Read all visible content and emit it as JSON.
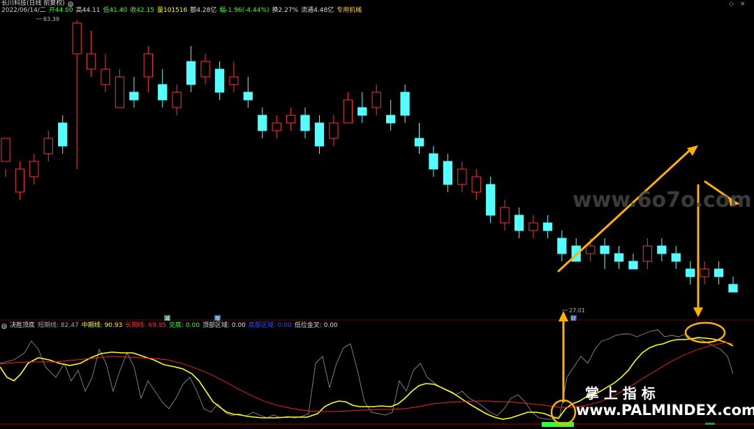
{
  "header": {
    "title": "长川科技(日线 前复权)",
    "date": "2022/06/14/二",
    "open": "开44.00",
    "high": "高44.11",
    "low": "低41.40",
    "close": "收42.15",
    "volume": "量101516",
    "amount": "额4.28亿",
    "change": "幅-1.96(-4.44%)",
    "turnover": "换2.27%",
    "float": "流通4.48亿",
    "sector": "专用机械"
  },
  "price_chart": {
    "max_label": "63.39",
    "min_label": "27.01",
    "marker_labels": [
      "减",
      "增",
      "财"
    ]
  },
  "indicator": {
    "name": "决胜顶底",
    "short": "短期线: 82.47",
    "mid": "中期线: 90.93",
    "long": "长期线: 69.95",
    "bottom": "见底: 0.00",
    "top_zone": "顶部区域: 0.00",
    "bottom_zone": "底部区域: 0.00",
    "golden": "低位金叉: 0.00"
  },
  "watermarks": {
    "top": "www.6o7o.com",
    "cn": "掌 上 指 标",
    "bottom": "www.PALMINDEX.com"
  },
  "colors": {
    "up": "#ff3333",
    "down": "#54ffff",
    "mid_line": "#ffff00",
    "long_line": "#ff2020",
    "short_line": "#9a9a9a",
    "arrow": "#ffb000"
  },
  "chart_data": {
    "type": "candlestick",
    "ylim": [
      26,
      64
    ],
    "candles": [
      [
        45,
        48,
        44,
        43
      ],
      [
        41,
        44,
        45,
        40
      ],
      [
        43,
        45,
        46,
        42
      ],
      [
        46,
        48,
        49,
        45
      ],
      [
        50,
        47,
        51,
        46
      ],
      [
        59,
        63,
        63.4,
        44
      ],
      [
        57,
        59,
        62,
        56
      ],
      [
        55,
        57,
        59,
        54
      ],
      [
        52,
        56,
        57,
        52
      ],
      [
        54,
        53,
        56,
        52
      ],
      [
        56,
        59,
        60,
        54
      ],
      [
        55,
        53,
        57,
        52
      ],
      [
        52,
        54,
        55,
        51
      ],
      [
        58,
        55,
        60,
        54
      ],
      [
        56,
        58,
        59,
        55
      ],
      [
        57,
        54,
        58,
        53
      ],
      [
        55,
        56,
        58,
        54
      ],
      [
        54,
        53,
        56,
        52
      ],
      [
        51,
        49,
        52,
        48
      ],
      [
        49,
        50,
        51,
        48
      ],
      [
        50,
        51,
        52,
        49
      ],
      [
        51,
        49,
        52,
        48
      ],
      [
        50,
        47,
        51,
        46
      ],
      [
        48,
        50,
        51,
        47
      ],
      [
        50,
        53,
        54,
        50
      ],
      [
        52,
        51,
        54,
        50
      ],
      [
        52,
        54,
        55,
        51
      ],
      [
        51,
        50,
        53,
        49
      ],
      [
        54,
        51,
        55,
        50
      ],
      [
        48,
        47,
        50,
        46
      ],
      [
        46,
        44,
        47,
        43
      ],
      [
        45,
        42,
        46,
        41
      ],
      [
        42,
        44,
        45,
        41
      ],
      [
        41,
        43,
        44,
        40
      ],
      [
        42,
        38,
        43,
        37
      ],
      [
        37,
        39,
        40,
        36
      ],
      [
        38,
        36,
        39,
        35
      ],
      [
        36,
        37,
        38,
        35
      ],
      [
        37,
        36,
        38,
        35
      ],
      [
        35,
        33,
        36,
        32
      ],
      [
        34,
        32,
        35,
        32
      ],
      [
        33,
        34,
        35,
        32
      ],
      [
        34,
        33,
        35,
        31
      ],
      [
        33,
        32,
        34,
        31
      ],
      [
        32,
        31,
        33,
        31
      ],
      [
        32,
        34,
        35,
        31
      ],
      [
        34,
        33,
        35,
        32
      ],
      [
        33,
        32,
        34,
        31
      ],
      [
        31,
        30,
        32,
        29
      ],
      [
        30,
        31,
        32,
        29
      ],
      [
        31,
        30,
        32,
        29
      ],
      [
        29,
        28,
        30,
        28
      ]
    ]
  }
}
